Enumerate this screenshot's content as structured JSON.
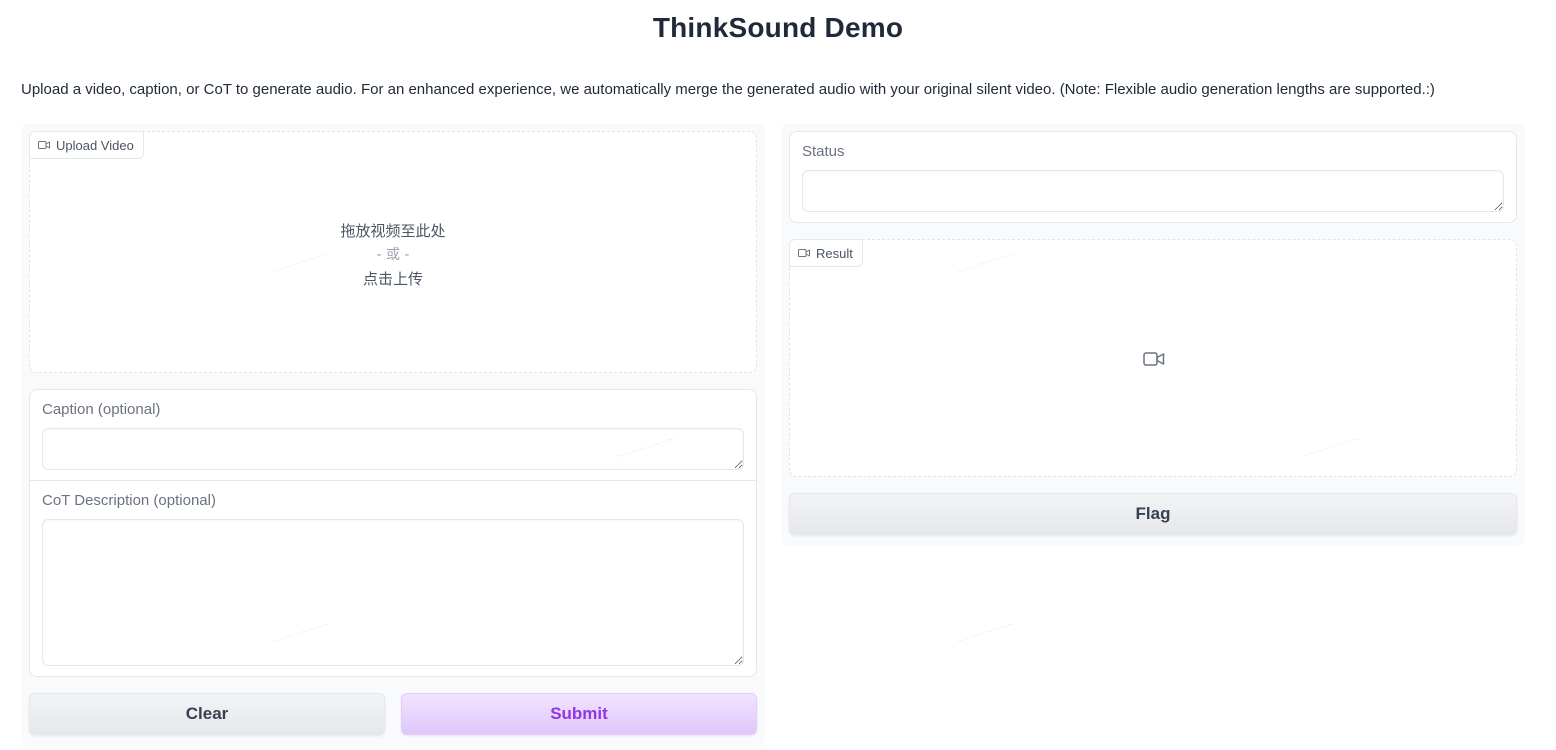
{
  "title": "ThinkSound Demo",
  "description": "Upload a video, caption, or CoT to generate audio. For an enhanced experience, we automatically merge the generated audio with your original silent video. (Note: Flexible audio generation lengths are supported.:)",
  "upload": {
    "label": "Upload Video",
    "icon": "video-icon",
    "drop_text": "拖放视频至此处",
    "or_text": "- 或 -",
    "click_text": "点击上传"
  },
  "caption": {
    "label": "Caption (optional)",
    "value": ""
  },
  "cot": {
    "label": "CoT Description (optional)",
    "value": ""
  },
  "buttons": {
    "clear": "Clear",
    "submit": "Submit",
    "flag": "Flag"
  },
  "status": {
    "label": "Status",
    "value": ""
  },
  "result": {
    "label": "Result",
    "icon": "video-icon",
    "placeholder_icon": "video-camera-icon"
  },
  "colors": {
    "primary_text": "#9333ea",
    "primary_bg": "#e8d5fd",
    "secondary_bg": "#e5e7eb"
  }
}
